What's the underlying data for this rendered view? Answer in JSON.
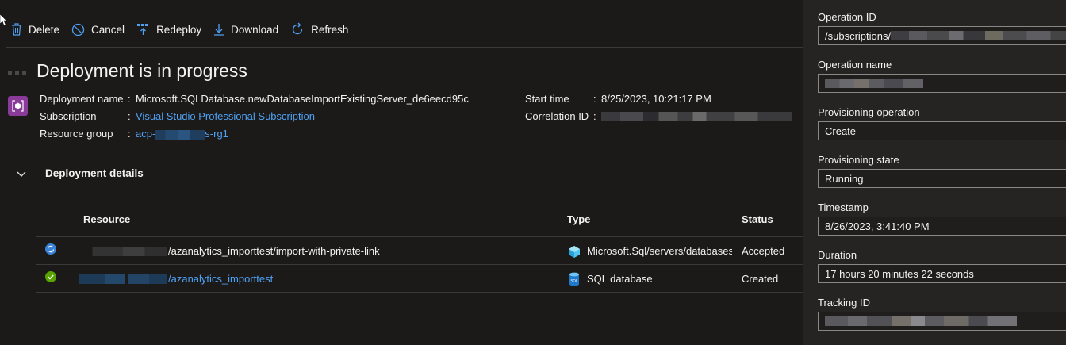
{
  "toolbar": {
    "delete": "Delete",
    "cancel": "Cancel",
    "redeploy": "Redeploy",
    "download": "Download",
    "refresh": "Refresh"
  },
  "page_title": "Deployment is in progress",
  "details": {
    "deployment_name_label": "Deployment name",
    "deployment_name_value": "Microsoft.SQLDatabase.newDatabaseImportExistingServer_de6eecd95c",
    "subscription_label": "Subscription",
    "subscription_value": "Visual Studio Professional Subscription",
    "resource_group_label": "Resource group",
    "resource_group_prefix": "acp-",
    "resource_group_suffix": "s-rg1",
    "start_time_label": "Start time",
    "start_time_value": "8/25/2023, 10:21:17 PM",
    "correlation_id_label": "Correlation ID",
    "separator": ":"
  },
  "deployment_details": {
    "title": "Deployment details",
    "columns": {
      "resource": "Resource",
      "type": "Type",
      "status": "Status"
    },
    "rows": [
      {
        "resource_suffix": "/azanalytics_importtest/import-with-private-link",
        "type": "Microsoft.Sql/servers/databases/",
        "status": "Accepted",
        "status_icon": "sync-icon",
        "type_icon": "cube-icon"
      },
      {
        "resource_suffix": "/azanalytics_importtest",
        "type": "SQL database",
        "status": "Created",
        "status_icon": "check-circle-icon",
        "type_icon": "sql-database-icon"
      }
    ]
  },
  "panel": {
    "operation_id_label": "Operation ID",
    "operation_id_value": "/subscriptions/",
    "operation_name_label": "Operation name",
    "provisioning_operation_label": "Provisioning operation",
    "provisioning_operation_value": "Create",
    "provisioning_state_label": "Provisioning state",
    "provisioning_state_value": "Running",
    "timestamp_label": "Timestamp",
    "timestamp_value": "8/26/2023, 3:41:40 PM",
    "duration_label": "Duration",
    "duration_value": "17 hours 20 minutes 22 seconds",
    "tracking_id_label": "Tracking ID"
  },
  "colors": {
    "background": "#1b1a19",
    "panel": "#252423",
    "link": "#4ea1f3",
    "accent_icon": "#4ea1f3",
    "success": "#57a300",
    "deployment_icon": "#8a3a98"
  }
}
